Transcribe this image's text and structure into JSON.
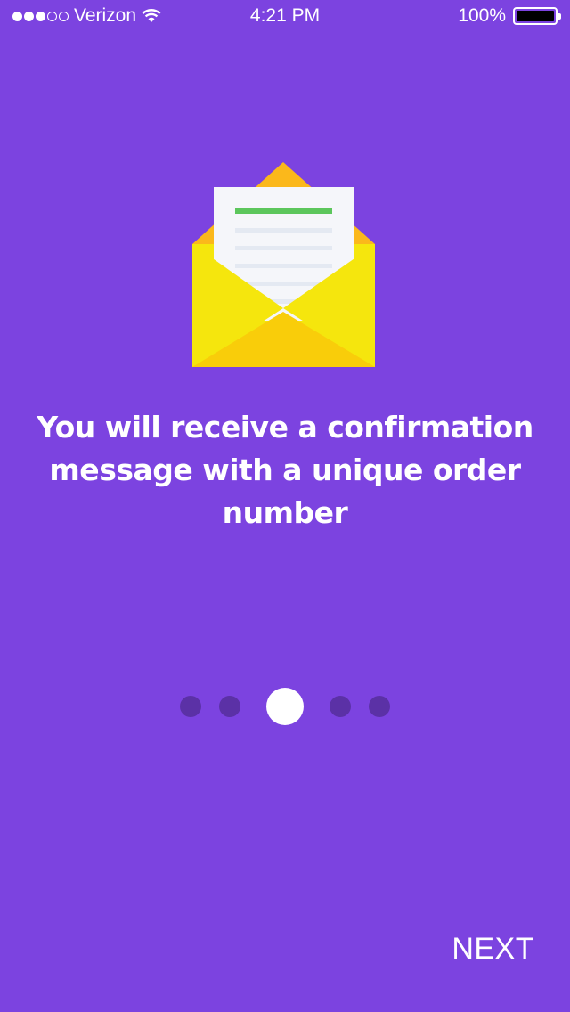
{
  "status_bar": {
    "signal_bars_filled": 3,
    "signal_bars_total": 5,
    "carrier": "Verizon",
    "time": "4:21 PM",
    "battery_percent": "100%",
    "wifi_icon": "wifi-icon",
    "battery_icon": "battery-icon"
  },
  "illustration": {
    "icon": "open-envelope-letter-icon"
  },
  "content": {
    "headline": "You will receive a confirmation message with a unique order number"
  },
  "pager": {
    "total": 5,
    "active_index": 2
  },
  "footer": {
    "next_label": "NEXT"
  },
  "colors": {
    "background": "#7c43e0",
    "envelope_flap": "#fbb81b",
    "envelope_body": "#f5e60d",
    "envelope_front": "#f9cd0a",
    "letter": "#f5f6fa",
    "letter_accent": "#5cc65c",
    "pager_active": "#ffffff",
    "pager_inactive": "#5b31a6"
  }
}
